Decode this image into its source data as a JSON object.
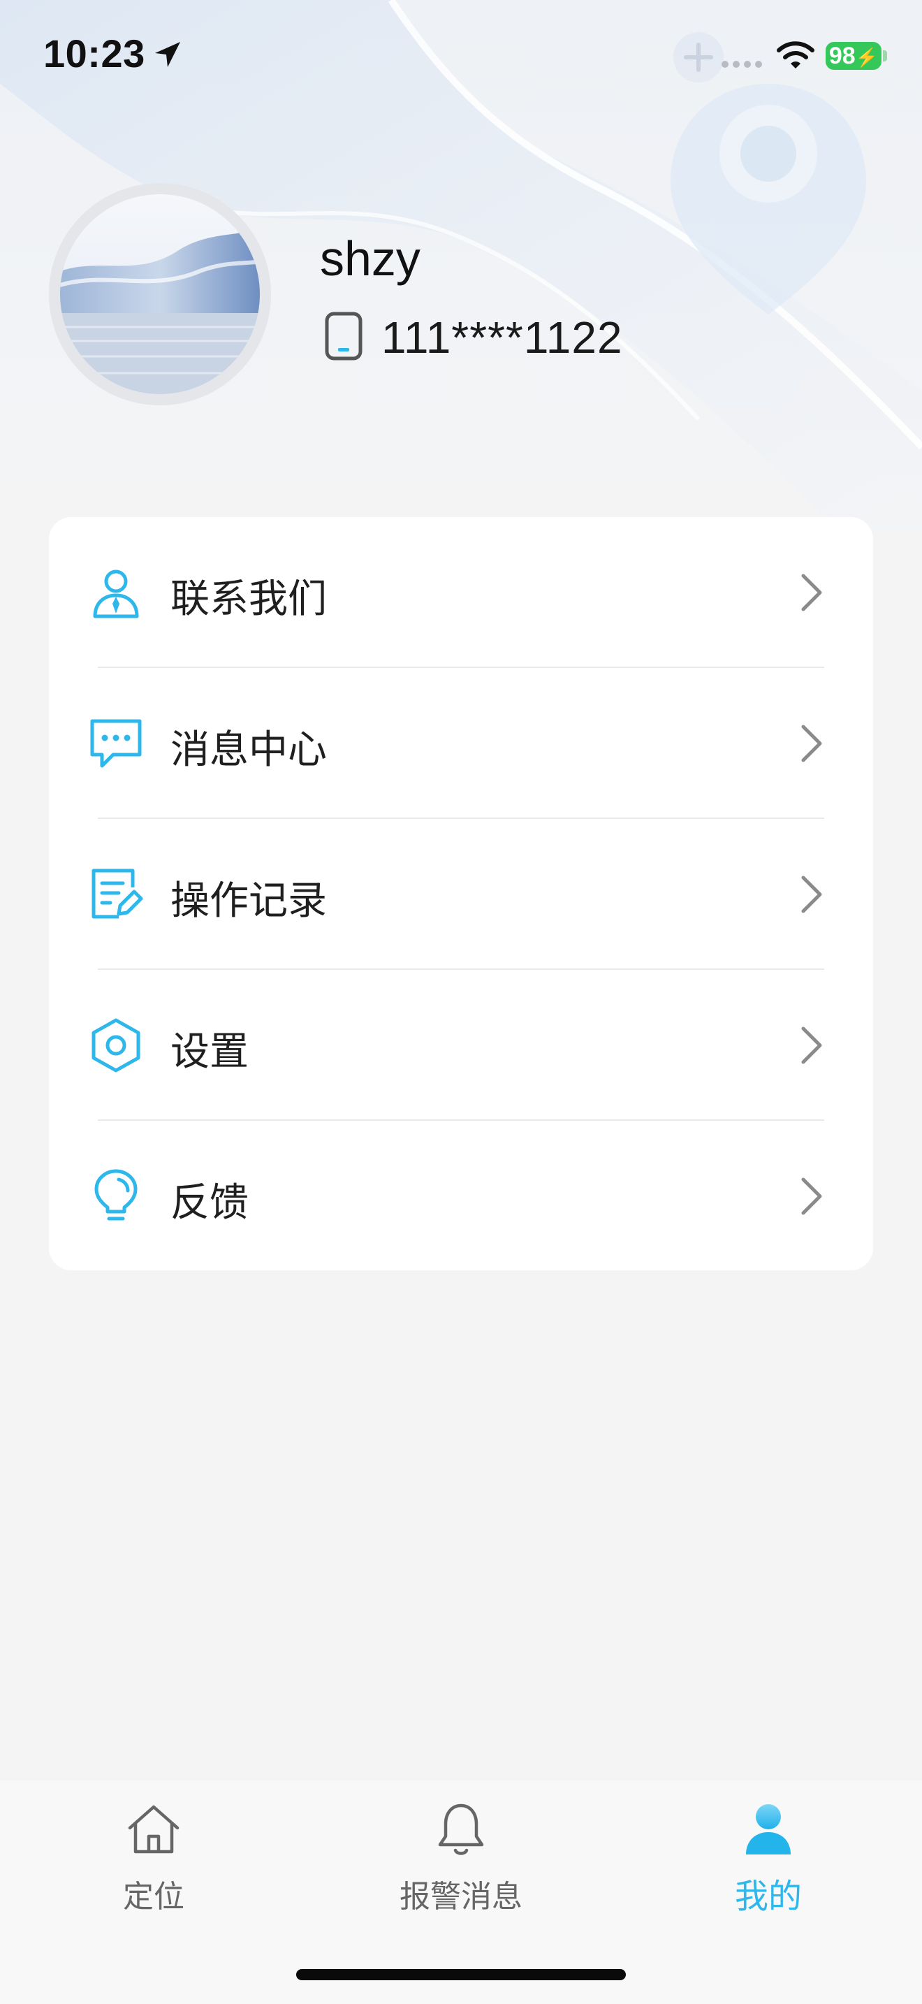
{
  "status_bar": {
    "time": "10:23",
    "battery": "98"
  },
  "profile": {
    "username": "shzy",
    "phone": "111****1122"
  },
  "menu": {
    "items": [
      {
        "label": "联系我们",
        "icon": "contact-person-icon"
      },
      {
        "label": "消息中心",
        "icon": "message-bubble-icon"
      },
      {
        "label": "操作记录",
        "icon": "edit-record-icon"
      },
      {
        "label": "设置",
        "icon": "hexagon-settings-icon"
      },
      {
        "label": "反馈",
        "icon": "lightbulb-icon"
      }
    ]
  },
  "tabs": [
    {
      "label": "定位",
      "icon": "home-icon",
      "active": false
    },
    {
      "label": "报警消息",
      "icon": "bell-icon",
      "active": false
    },
    {
      "label": "我的",
      "icon": "user-icon",
      "active": true
    }
  ],
  "colors": {
    "accent": "#2db7ea",
    "battery": "#34c759"
  }
}
